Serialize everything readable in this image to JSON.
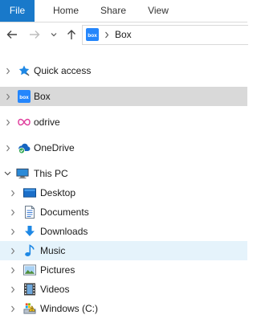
{
  "ribbon": {
    "tabs": [
      {
        "label": "File"
      },
      {
        "label": "Home"
      },
      {
        "label": "Share"
      },
      {
        "label": "View"
      }
    ]
  },
  "address": {
    "path": "Box",
    "icon_text": "box"
  },
  "tree": {
    "items": [
      {
        "label": "Quick access",
        "icon": "star-pin-icon"
      },
      {
        "label": "Box",
        "icon": "box-icon",
        "state": "selected"
      },
      {
        "label": "odrive",
        "icon": "infinity-icon"
      },
      {
        "label": "OneDrive",
        "icon": "cloud-check-icon"
      },
      {
        "label": "This PC",
        "icon": "computer-icon",
        "expanded": true
      },
      {
        "label": "Desktop",
        "icon": "desktop-icon"
      },
      {
        "label": "Documents",
        "icon": "document-icon"
      },
      {
        "label": "Downloads",
        "icon": "download-arrow-icon"
      },
      {
        "label": "Music",
        "icon": "music-note-icon",
        "state": "hover"
      },
      {
        "label": "Pictures",
        "icon": "picture-icon"
      },
      {
        "label": "Videos",
        "icon": "film-icon"
      },
      {
        "label": "Windows (C:)",
        "icon": "drive-icon"
      }
    ]
  },
  "colors": {
    "file_tab": "#1979ca",
    "selected_row": "#d9d9d9",
    "hover_row": "#e5f3fb",
    "box_brand": "#2486fc",
    "odrive_pink": "#e0409e"
  }
}
